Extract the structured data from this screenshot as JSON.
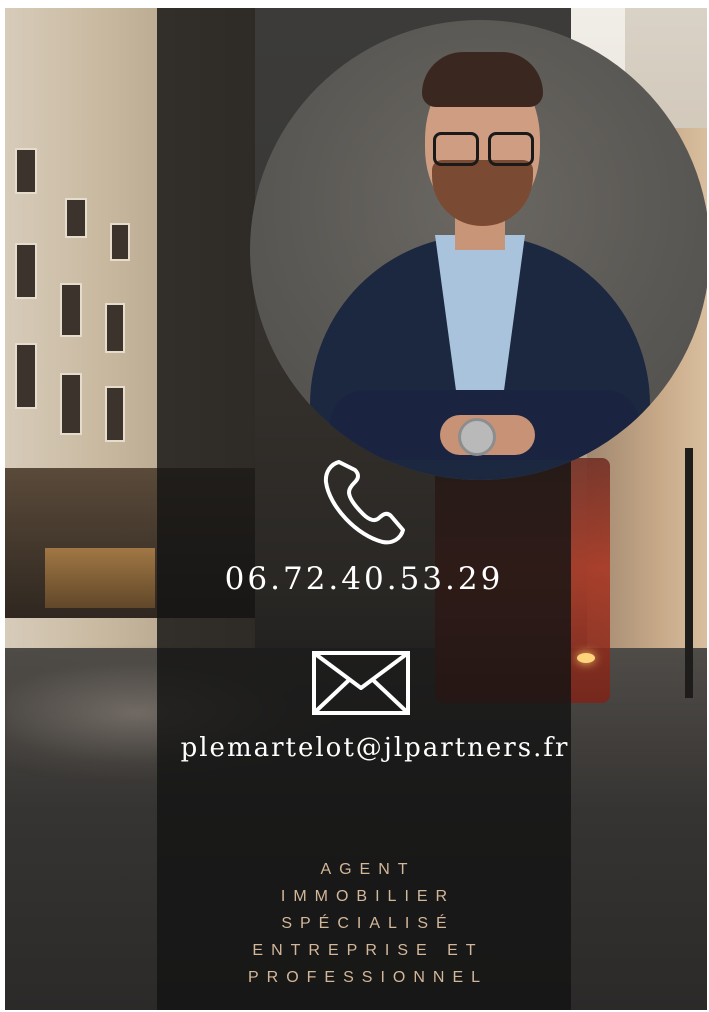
{
  "contact": {
    "phone_icon": "phone-handset-icon",
    "phone": "06.72.40.53.29",
    "mail_icon": "envelope-icon",
    "email": "plemartelot@jlpartners.fr"
  },
  "role": {
    "lines": [
      "AGENT",
      "IMMOBILIER",
      "SPÉCIALISÉ",
      "ENTREPRISE ET",
      "PROFESSIONNEL"
    ]
  },
  "colors": {
    "panel": "#141414",
    "text": "#ffffff",
    "accent": "#d3b79a"
  }
}
